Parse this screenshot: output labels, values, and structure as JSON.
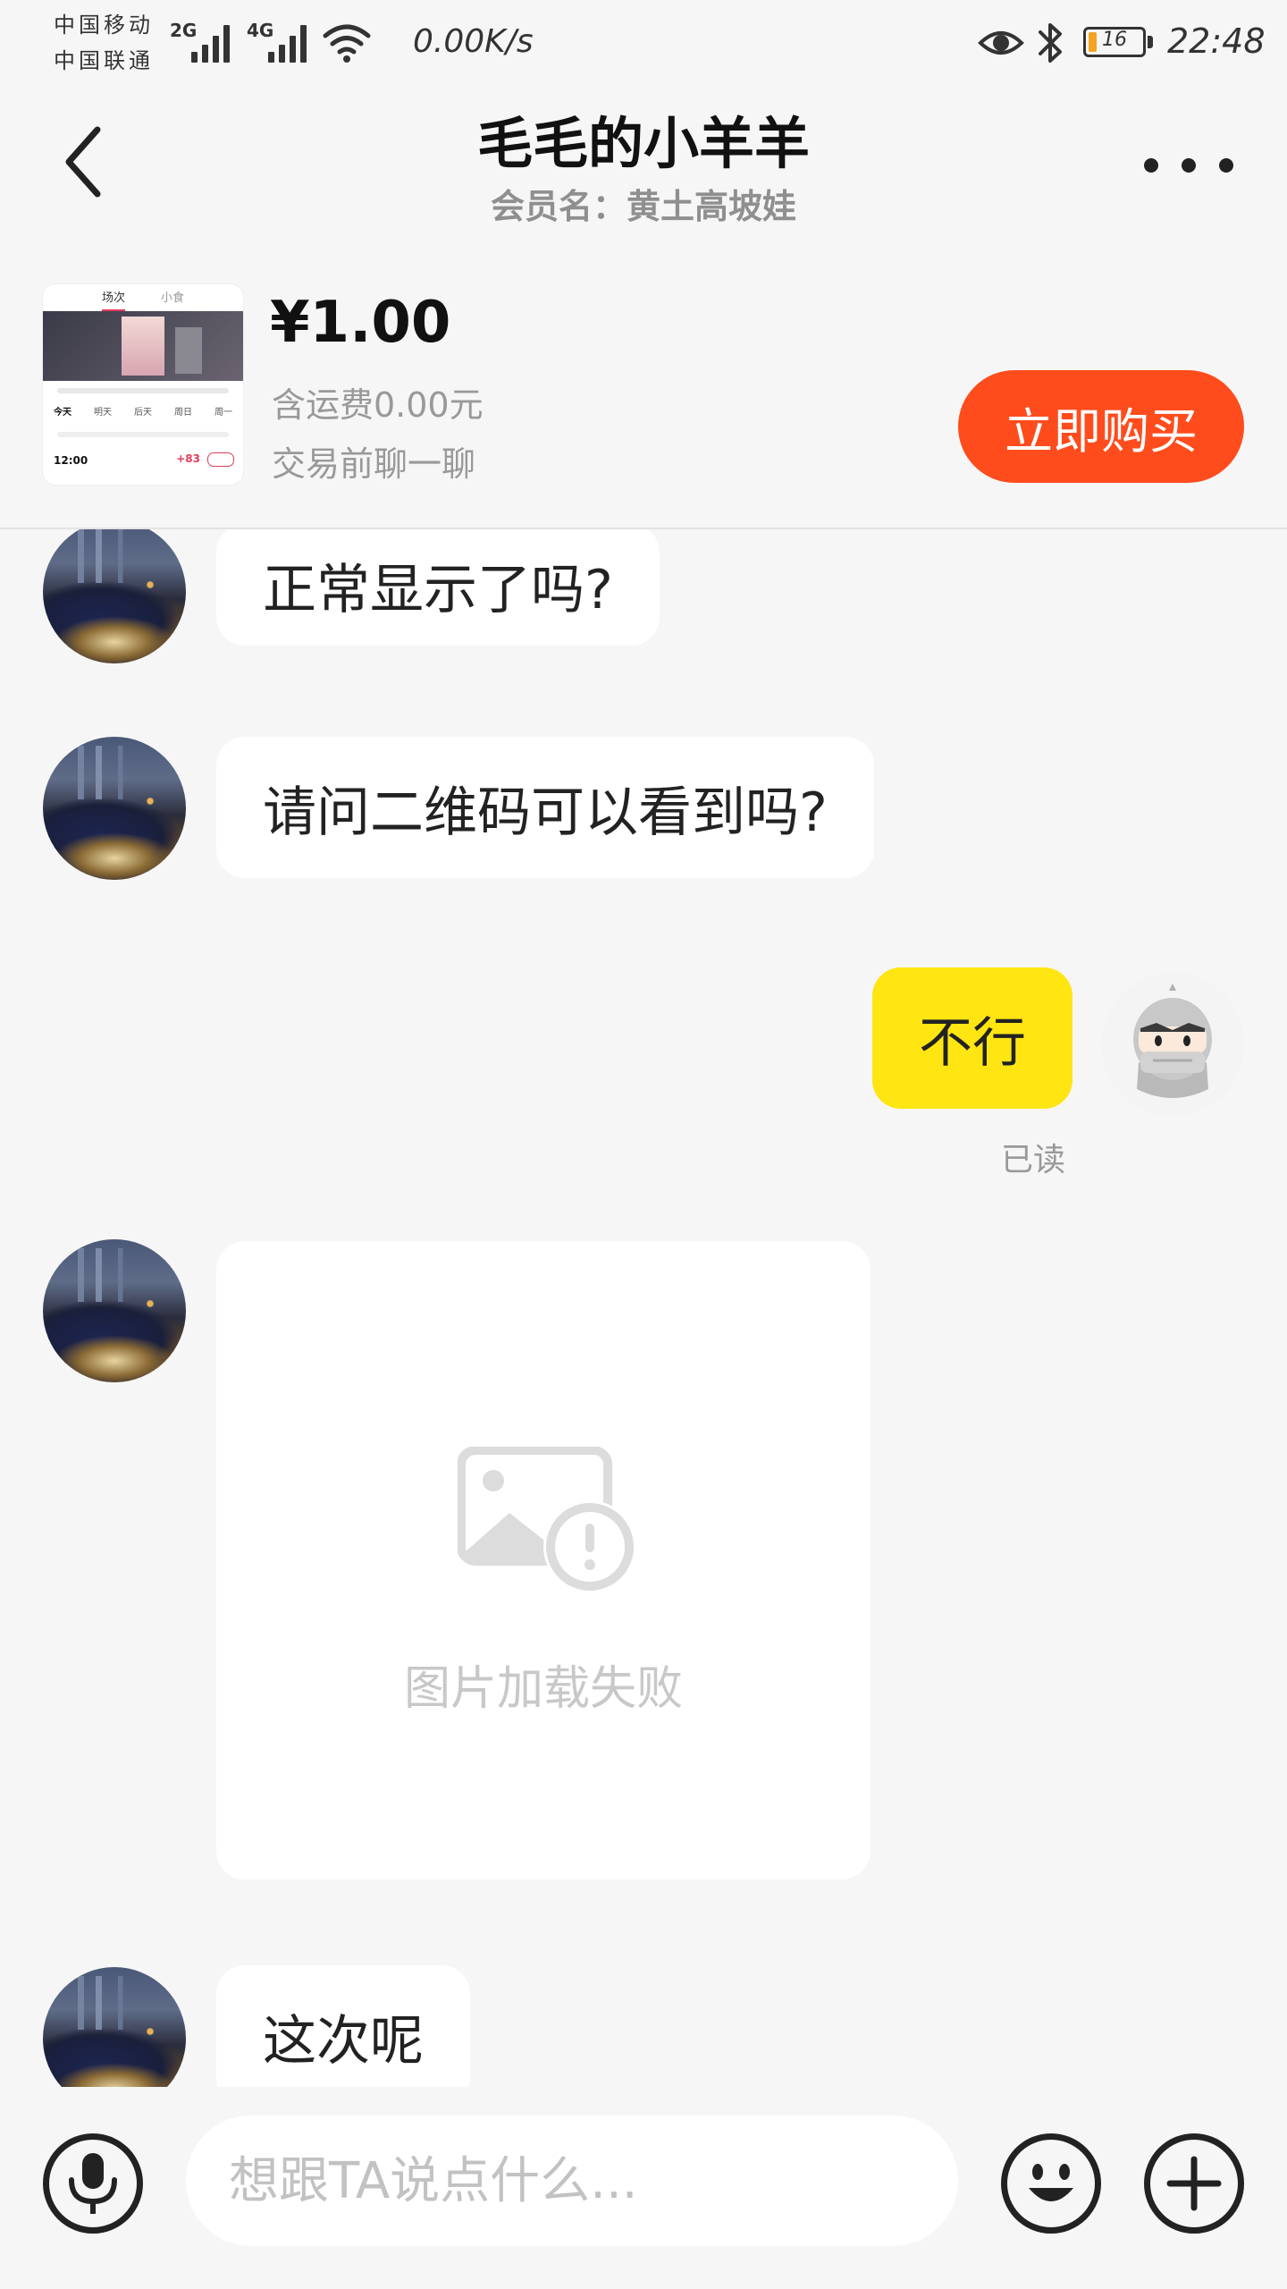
{
  "status_bar": {
    "carrier_1": "中国移动",
    "carrier_2": "中国联通",
    "network_1": "2G",
    "network_2": "4G",
    "speed": "0.00K/s",
    "battery_level": "16",
    "battery_fraction": 0.16,
    "battery_color": "#f3a320",
    "time": "22:48",
    "icons": [
      "signal-icon",
      "wifi-icon",
      "eye-icon",
      "bluetooth-icon",
      "battery-icon"
    ]
  },
  "header": {
    "title": "毛毛的小羊羊",
    "subtitle": "会员名：黄土高坡娃",
    "icons": [
      "back-arrow-icon",
      "more-dots-icon"
    ]
  },
  "product": {
    "thumb": {
      "tab_active": "场次",
      "tab_other": "小食",
      "day": "今天",
      "day_2": "明天",
      "day_3": "后天",
      "day_4": "周日",
      "day_5": "周一",
      "time": "12:00",
      "extra": "+83"
    },
    "price": "¥1.00",
    "shipping": "含运费0.00元",
    "note": "交易前聊一聊",
    "buy_label": "立即购买",
    "buy_color": "#ff4c1d"
  },
  "messages": [
    {
      "from": "other",
      "text": "正常显示了吗?"
    },
    {
      "from": "other",
      "text": "请问二维码可以看到吗?"
    },
    {
      "from": "me",
      "text": "不行",
      "status": "已读"
    },
    {
      "from": "other",
      "type": "image",
      "text": "图片加载失败"
    },
    {
      "from": "other",
      "text": "这次呢"
    }
  ],
  "colors": {
    "my_bubble": "#ffe511",
    "other_bubble": "#ffffff",
    "background": "#f6f6f6"
  },
  "input_bar": {
    "placeholder": "想跟TA说点什么...",
    "value": "",
    "icons": [
      "microphone-icon",
      "emoji-icon",
      "plus-icon"
    ]
  }
}
